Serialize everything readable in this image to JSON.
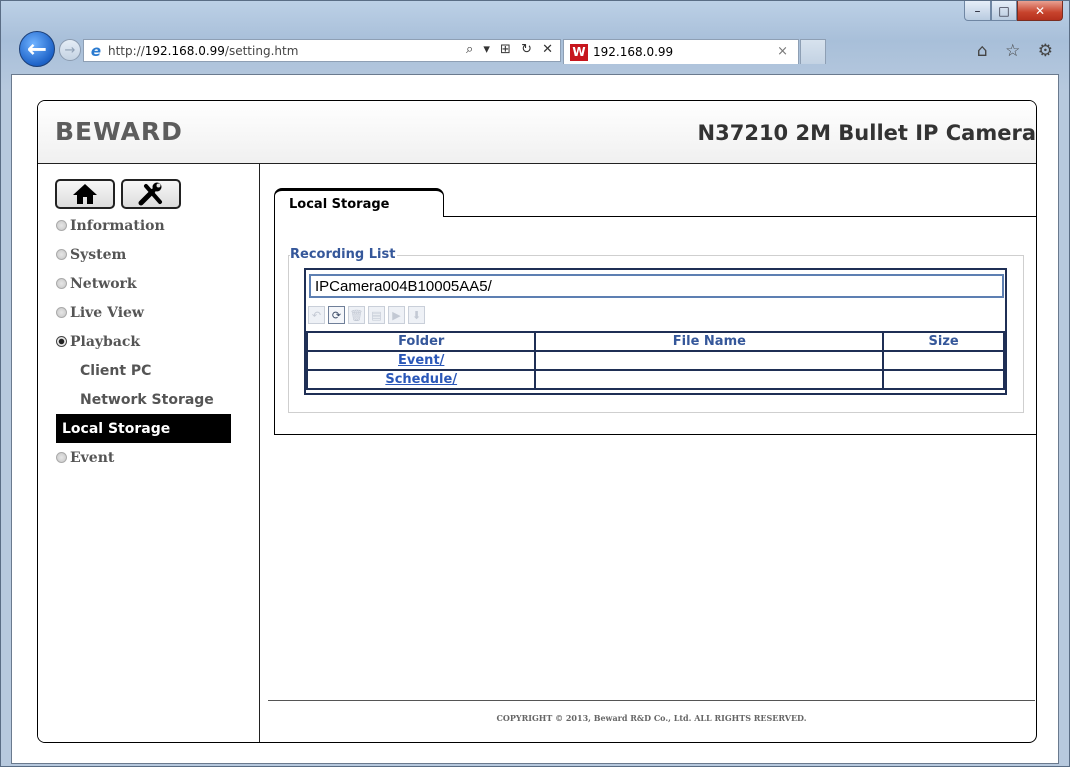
{
  "browser": {
    "address_scheme": "http://",
    "address_host": "192.168.0.99",
    "address_path": "/setting.htm",
    "address_tools": "⌕ ▾ ⊞ ↻ ✕",
    "tab_title": "192.168.0.99",
    "tab_close": "×",
    "window_controls": {
      "minimize": "–",
      "maximize": "□",
      "close": "✕"
    },
    "toolbar_icons": "⌂ ☆ ⚙"
  },
  "header": {
    "logo": "BEWARD",
    "camera_title": "N37210 2M Bullet IP Camera"
  },
  "sidebar": {
    "menu": [
      {
        "label": "Information",
        "selected": false
      },
      {
        "label": "System",
        "selected": false
      },
      {
        "label": "Network",
        "selected": false
      },
      {
        "label": "Live View",
        "selected": false
      },
      {
        "label": "Playback",
        "selected": true
      }
    ],
    "submenu": [
      {
        "label": "Client PC",
        "active": false
      },
      {
        "label": "Network Storage",
        "active": false
      },
      {
        "label": "Local Storage",
        "active": true
      }
    ],
    "last_menu": {
      "label": "Event",
      "selected": false
    }
  },
  "main": {
    "tab_label": "Local Storage",
    "recording_list_legend": "Recording List",
    "path_value": "IPCamera004B10005AA5/",
    "toolbar_icons": [
      "back",
      "refresh",
      "delete",
      "copy",
      "play",
      "download"
    ],
    "table": {
      "headers": [
        "Folder",
        "File Name",
        "Size"
      ],
      "rows": [
        [
          "Event/",
          "",
          ""
        ],
        [
          "Schedule/",
          "",
          ""
        ]
      ]
    }
  },
  "footer": {
    "copyright": "COPYRIGHT © 2013, Beward R&D Co., Ltd. ALL RIGHTS RESERVED."
  },
  "colors": {
    "legend_blue": "#35579a",
    "link_blue": "#2a57b8",
    "active_menu_bg": "#000000",
    "table_border": "#1f2f55"
  }
}
